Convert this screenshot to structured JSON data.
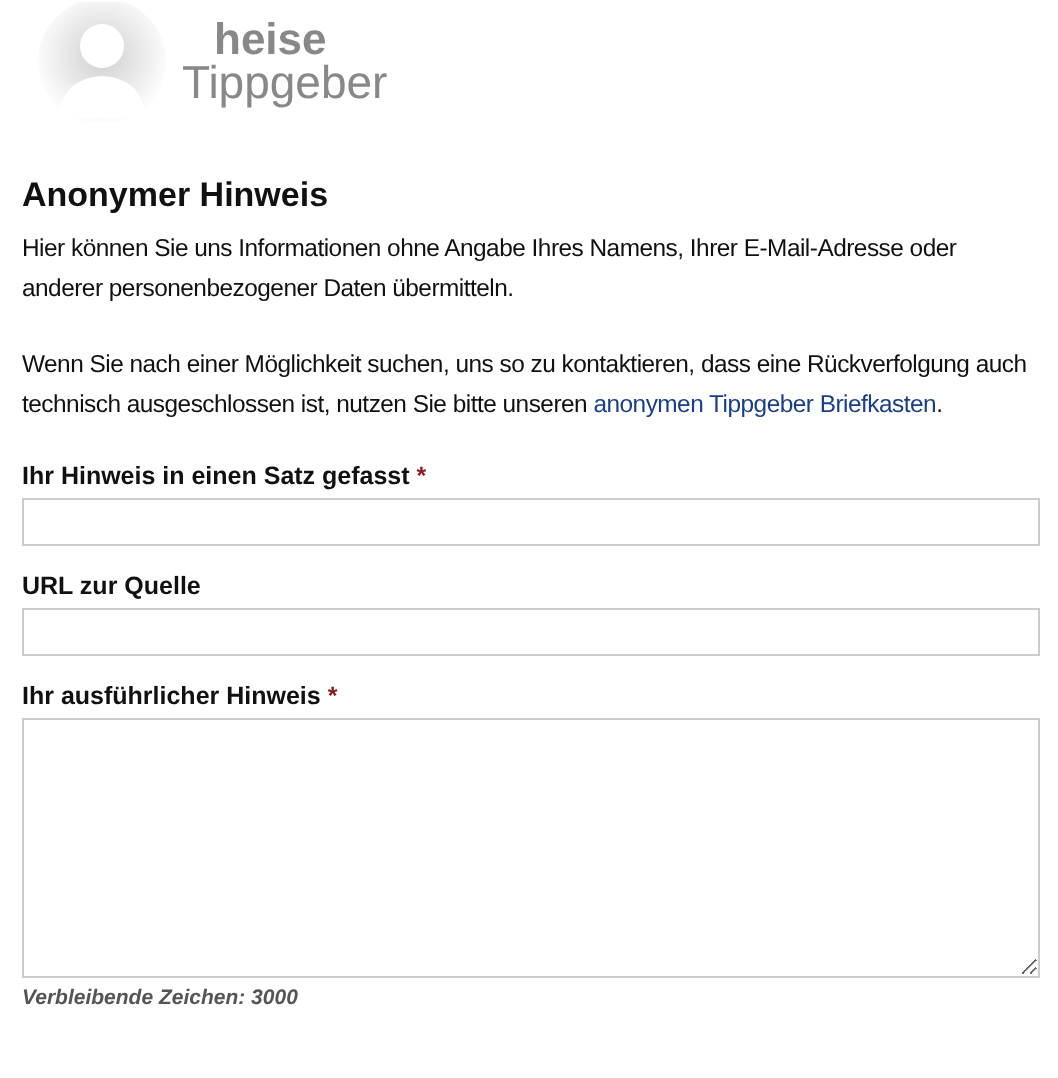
{
  "logo": {
    "line_1": "heise",
    "line_2": "Tippgeber"
  },
  "heading": "Anonymer Hinweis",
  "intro": "Hier können Sie uns Informationen ohne Angabe Ihres Namens, Ihrer E-Mail-Adresse oder anderer personenbezogener Daten übermitteln.",
  "note": {
    "before": "Wenn Sie nach einer Möglichkeit suchen, uns so zu kontaktieren, dass eine Rückverfolgung auch technisch ausgeschlossen ist, nutzen Sie bitte unseren ",
    "link": "anonymen Tippgeber Briefkasten",
    "after": "."
  },
  "fields": [
    {
      "kind": "input",
      "label": "Ihr Hinweis in einen Satz gefasst",
      "required_mark": "*"
    },
    {
      "kind": "input",
      "label": "URL zur Quelle"
    },
    {
      "kind": "textarea",
      "label": "Ihr ausführlicher Hinweis",
      "required_mark": "*"
    }
  ],
  "counter": "Verbleibende Zeichen: 3000"
}
